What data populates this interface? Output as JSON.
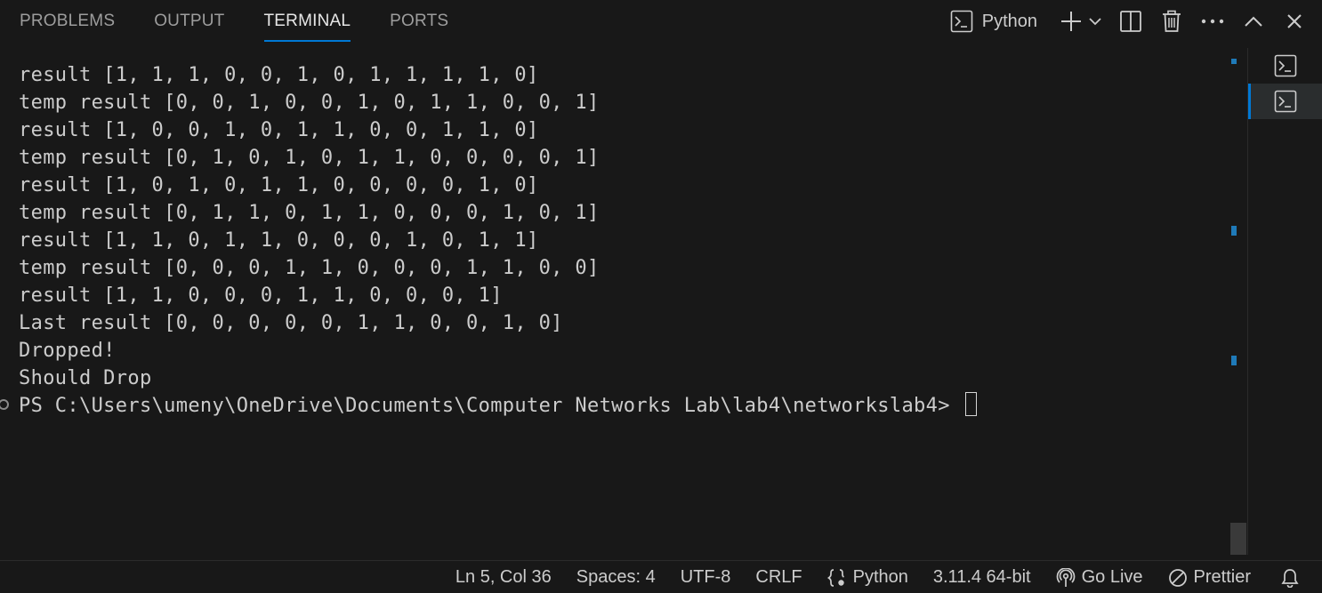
{
  "panel": {
    "tabs": [
      {
        "label": "PROBLEMS",
        "active": false
      },
      {
        "label": "OUTPUT",
        "active": false
      },
      {
        "label": "TERMINAL",
        "active": true
      },
      {
        "label": "PORTS",
        "active": false
      }
    ],
    "actions": {
      "launch_profile_label": "Python",
      "new_terminal_icon": "plus-icon",
      "dropdown_icon": "chevron-down-icon",
      "split_icon": "split-editor-icon",
      "kill_icon": "trash-icon",
      "more_icon": "ellipsis-icon",
      "maximize_icon": "chevron-up-icon",
      "close_icon": "close-icon"
    }
  },
  "terminal": {
    "lines": [
      "result [1, 1, 1, 0, 0, 1, 0, 1, 1, 1, 1, 0]",
      "temp result [0, 0, 1, 0, 0, 1, 0, 1, 1, 0, 0, 1]",
      "result [1, 0, 0, 1, 0, 1, 1, 0, 0, 1, 1, 0]",
      "temp result [0, 1, 0, 1, 0, 1, 1, 0, 0, 0, 0, 1]",
      "result [1, 0, 1, 0, 1, 1, 0, 0, 0, 0, 1, 0]",
      "temp result [0, 1, 1, 0, 1, 1, 0, 0, 0, 1, 0, 1]",
      "result [1, 1, 0, 1, 1, 0, 0, 0, 1, 0, 1, 1]",
      "temp result [0, 0, 0, 1, 1, 0, 0, 0, 1, 1, 0, 0]",
      "result [1, 1, 0, 0, 0, 1, 1, 0, 0, 0, 1]",
      "Last result [0, 0, 0, 0, 0, 1, 1, 0, 0, 1, 0]",
      "Dropped!",
      "Should Drop"
    ],
    "prompt": "PS C:\\Users\\umeny\\OneDrive\\Documents\\Computer Networks Lab\\lab4\\networkslab4> "
  },
  "terminal_list": {
    "items": [
      {
        "icon": "terminal-icon",
        "active": false
      },
      {
        "icon": "terminal-icon",
        "active": true
      }
    ]
  },
  "colors": {
    "accent": "#0078d4",
    "background": "#181818",
    "foreground": "#cccccc",
    "ruler_mark": "#1f7ab8"
  },
  "statusbar": {
    "position": "Ln 5, Col 36",
    "spaces": "Spaces: 4",
    "encoding": "UTF-8",
    "eol": "CRLF",
    "language": "Python",
    "interpreter": "3.11.4 64-bit",
    "go_live": "Go Live",
    "prettier": "Prettier",
    "notifications_icon": "bell-icon"
  }
}
